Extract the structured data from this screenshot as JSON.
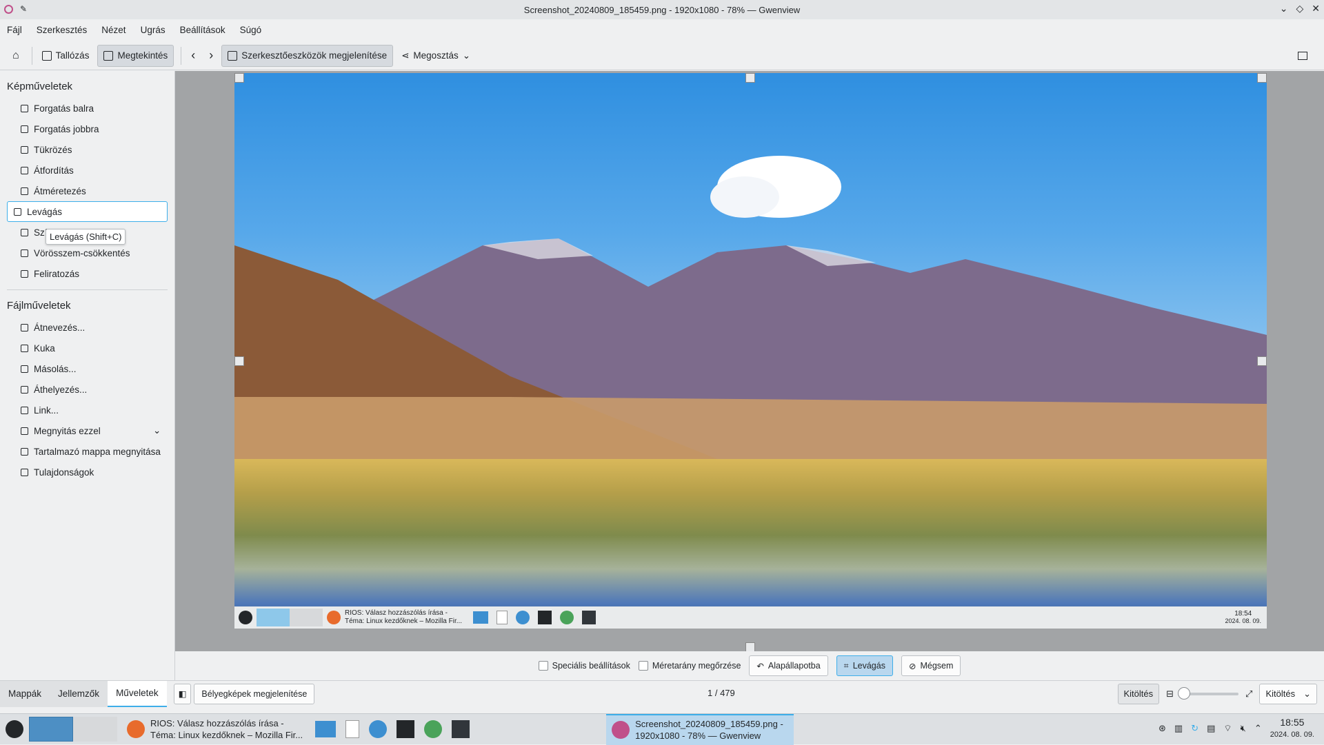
{
  "window": {
    "title": "Screenshot_20240809_185459.png - 1920x1080 - 78% — Gwenview"
  },
  "menu": [
    "Fájl",
    "Szerkesztés",
    "Nézet",
    "Ugrás",
    "Beállítások",
    "Súgó"
  ],
  "toolbar": {
    "browse": "Tallózás",
    "view": "Megtekintés",
    "show_editing_tools": "Szerkesztőeszközök megjelenítése",
    "share": "Megosztás"
  },
  "sidebar": {
    "image_ops_header": "Képműveletek",
    "image_ops": [
      "Forgatás balra",
      "Forgatás jobbra",
      "Tükrözés",
      "Átfordítás",
      "Átméretezés",
      "Levágás",
      "Színek",
      "Vörösszem-csökkentés",
      "Feliratozás"
    ],
    "file_ops_header": "Fájlműveletek",
    "file_ops": [
      "Átnevezés...",
      "Kuka",
      "Másolás...",
      "Áthelyezés...",
      "Link...",
      "Megnyitás ezzel",
      "Tartalmazó mappa megnyitása",
      "Tulajdonságok"
    ],
    "tooltip": "Levágás (Shift+C)"
  },
  "crop": {
    "advanced": "Speciális beállítások",
    "keep_ratio": "Méretarány megőrzése",
    "reset": "Alapállapotba",
    "crop": "Levágás",
    "cancel": "Mégsem"
  },
  "inner_taskbar": {
    "window_text": "RIOS: Válasz hozzászólás írása - Téma: Linux kezdőknek – Mozilla Fir...",
    "time": "18:54",
    "date": "2024. 08. 09."
  },
  "status": {
    "tabs": [
      "Mappák",
      "Jellemzők",
      "Műveletek"
    ],
    "thumbnails": "Bélyegképek megjelenítése",
    "counter": "1 / 479",
    "fit": "Kitöltés",
    "fit_select": "Kitöltés",
    "zoom_level": 0.0
  },
  "taskbar": {
    "firefox_line1": "RIOS: Válasz hozzászólás írása -",
    "firefox_line2": "Téma: Linux kezdőknek – Mozilla Fir...",
    "gwen_line1": "Screenshot_20240809_185459.png -",
    "gwen_line2": "1920x1080 - 78% — Gwenview",
    "time": "18:55",
    "date": "2024. 08. 09."
  }
}
